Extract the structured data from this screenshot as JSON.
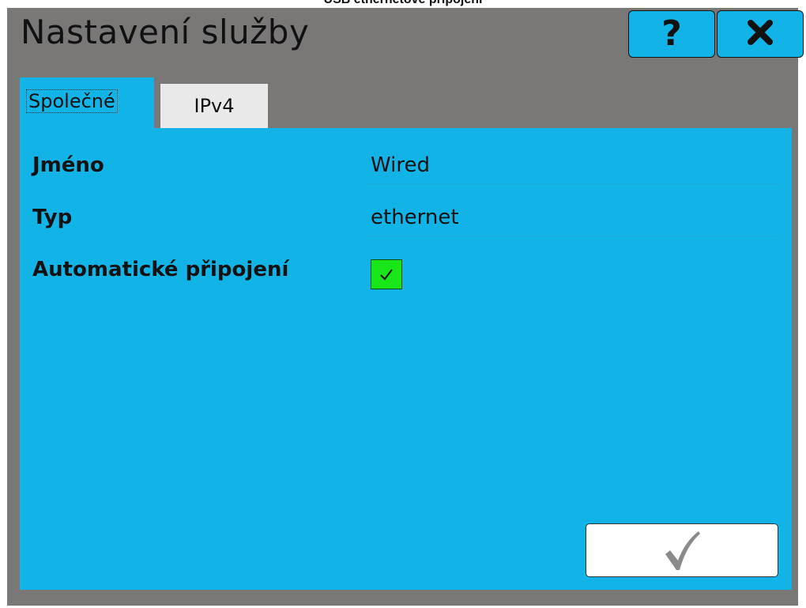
{
  "window": {
    "caption": "USB ethernetové připojení"
  },
  "dialog": {
    "title": "Nastavení služby",
    "help_label": "?",
    "close_icon": "close-icon"
  },
  "tabs": [
    {
      "label": "Společné",
      "active": true
    },
    {
      "label": "IPv4",
      "active": false
    }
  ],
  "fields": [
    {
      "label": "Jméno",
      "value": "Wired"
    },
    {
      "label": "Typ",
      "value": "ethernet"
    },
    {
      "label": "Automatické připojení",
      "checked": true
    }
  ],
  "confirm_icon": "checkmark-icon",
  "colors": {
    "dialog_bg": "#7a7777",
    "accent": "#12b3e6",
    "checkbox": "#19e619",
    "tab_inactive": "#e9e9e9"
  }
}
